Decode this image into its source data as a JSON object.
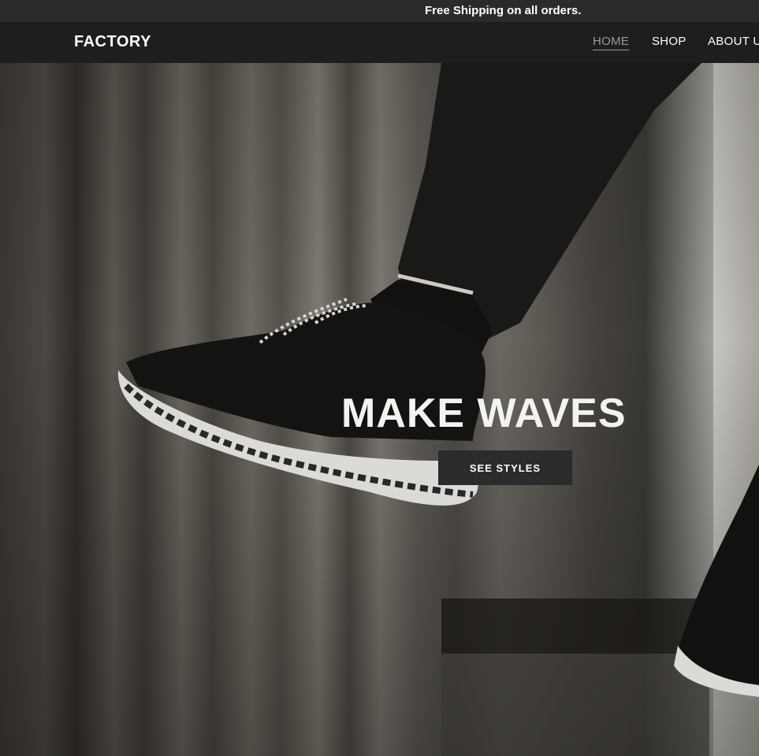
{
  "announcement": {
    "text": "Free Shipping on all orders."
  },
  "header": {
    "logo": "FACTORY",
    "nav": [
      {
        "label": "HOME",
        "active": true
      },
      {
        "label": "SHOP",
        "active": false
      },
      {
        "label": "ABOUT U",
        "active": false
      }
    ]
  },
  "hero": {
    "headline": "MAKE WAVES",
    "cta_label": "SEE STYLES"
  },
  "colors": {
    "announcement_bg": "#2b2b2d",
    "header_bg": "#1e1e1f",
    "active_nav": "#9a9a9a",
    "button_bg": "#2b2b2d",
    "text": "#ffffff"
  },
  "icons": [
    "sneaker-image"
  ]
}
